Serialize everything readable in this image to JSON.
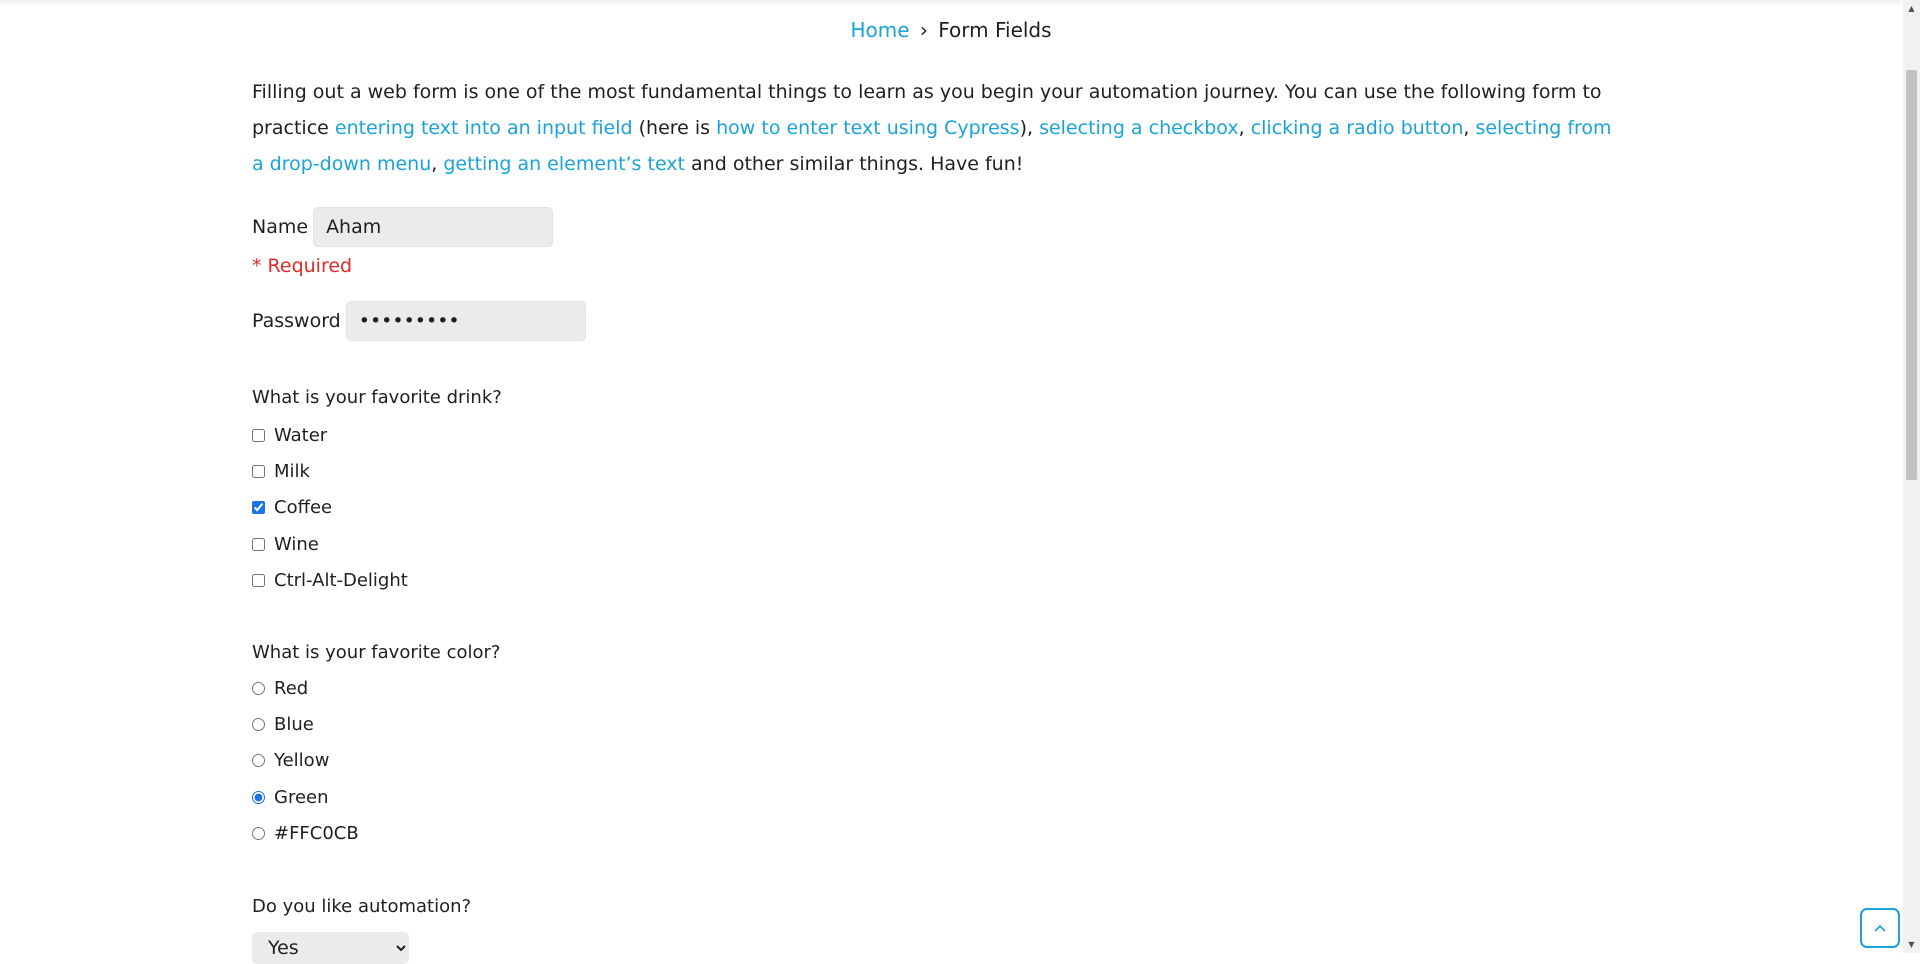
{
  "breadcrumb": {
    "home": "Home",
    "separator": "›",
    "current": "Form Fields"
  },
  "intro": {
    "part1": "Filling out a web form is one of the most fundamental things to learn as you begin your automation journey. You can use the following form to practice ",
    "link1": "entering text into an input field",
    "part2": " (here is ",
    "link2": "how to enter text using Cypress",
    "part3": "), ",
    "link3": "selecting a checkbox",
    "comma1": ", ",
    "link4": "clicking a radio button",
    "comma2": ", ",
    "link5": "selecting from a drop-down menu",
    "comma3": ", ",
    "link6": "getting an element’s text",
    "part4": " and other similar things. Have fun!"
  },
  "name_field": {
    "label": "Name",
    "value": "Aham",
    "required": "* Required"
  },
  "password_field": {
    "label": "Password",
    "value": "pswdpswd1"
  },
  "drink": {
    "question": "What is your favorite drink?",
    "options": [
      {
        "label": "Water",
        "checked": false
      },
      {
        "label": "Milk",
        "checked": false
      },
      {
        "label": "Coffee",
        "checked": true
      },
      {
        "label": "Wine",
        "checked": false
      },
      {
        "label": "Ctrl-Alt-Delight",
        "checked": false
      }
    ]
  },
  "color": {
    "question": "What is your favorite color?",
    "options": [
      {
        "label": "Red",
        "checked": false
      },
      {
        "label": "Blue",
        "checked": false
      },
      {
        "label": "Yellow",
        "checked": false
      },
      {
        "label": "Green",
        "checked": true
      },
      {
        "label": "#FFC0CB",
        "checked": false
      }
    ]
  },
  "automation": {
    "question": "Do you like automation?",
    "selected": "Yes"
  },
  "scroll_top": {
    "icon": "chevron-up-icon"
  },
  "colors": {
    "link": "#1aa3d9",
    "required": "#e02a2a",
    "input_bg": "#ebebeb"
  }
}
